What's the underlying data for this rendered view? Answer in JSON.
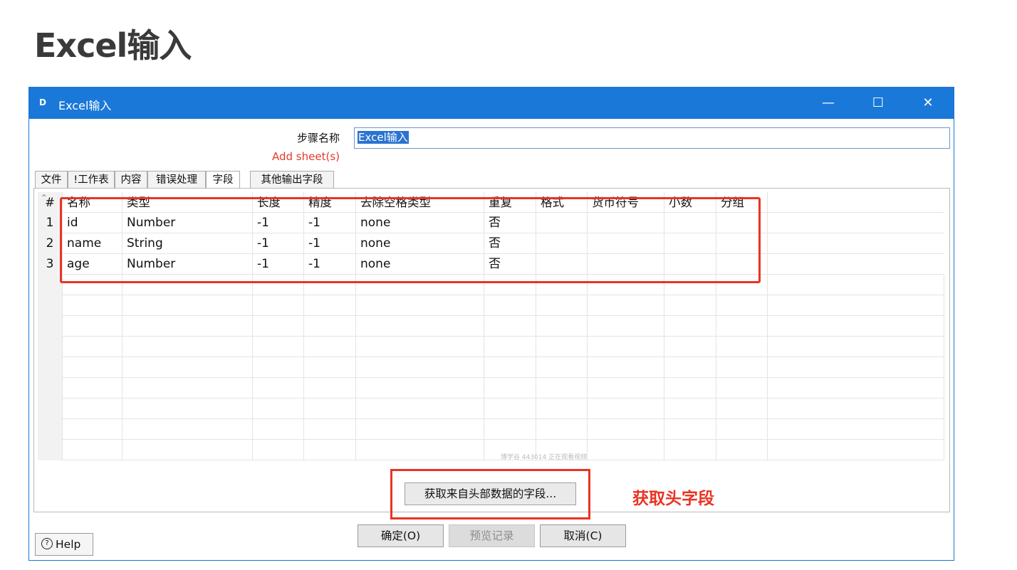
{
  "slide": {
    "title": "Excel输入"
  },
  "window": {
    "title": "Excel输入",
    "controls": {
      "minimize": "—",
      "maximize": "☐",
      "close": "✕"
    }
  },
  "step": {
    "label": "步骤名称",
    "value": "Excel输入"
  },
  "annotations": {
    "add_sheet": "Add sheet(s)",
    "get_header": "获取头字段"
  },
  "tabs": [
    "文件",
    "!工作表",
    "内容",
    "错误处理",
    "字段",
    "其他输出字段"
  ],
  "active_tab": "字段",
  "table": {
    "headers": [
      "#",
      "名称",
      "类型",
      "长度",
      "精度",
      "去除空格类型",
      "重复",
      "格式",
      "货币符号",
      "小数",
      "分组"
    ],
    "rows": [
      [
        "1",
        "id",
        "Number",
        "-1",
        "-1",
        "none",
        "否",
        "",
        "",
        "",
        ""
      ],
      [
        "2",
        "name",
        "String",
        "-1",
        "-1",
        "none",
        "否",
        "",
        "",
        "",
        ""
      ],
      [
        "3",
        "age",
        "Number",
        "-1",
        "-1",
        "none",
        "否",
        "",
        "",
        "",
        ""
      ]
    ]
  },
  "watermark": "博学谷 443014 正在观看视频",
  "buttons": {
    "get_fields": "获取来自头部数据的字段...",
    "help": "Help",
    "ok": "确定(O)",
    "preview": "预览记录",
    "cancel": "取消(C)"
  },
  "colors": {
    "titlebar": "#1a78d8",
    "annotation": "#ea3323"
  }
}
